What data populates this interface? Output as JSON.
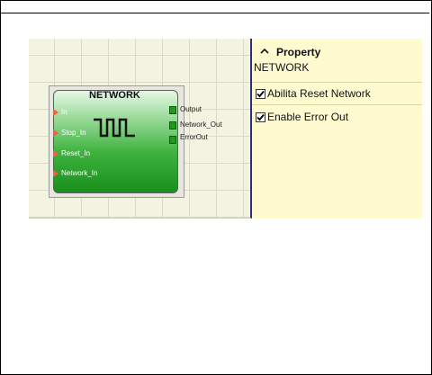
{
  "block": {
    "title": "NETWORK",
    "inputs": [
      "In",
      "Stop_In",
      "Reset_In",
      "Network_In"
    ],
    "outputs": [
      "Output",
      "Network_Out",
      "ErrorOut"
    ]
  },
  "property_panel": {
    "header": "Property",
    "subtitle": "NETWORK",
    "options": [
      {
        "label": "Abilita Reset Network",
        "checked": true
      },
      {
        "label": "Enable Error Out",
        "checked": true
      }
    ]
  },
  "colors": {
    "canvas_bg": "#f3f3e2",
    "panel_bg": "#fffad0",
    "block_green": "#3fb33f",
    "input_arrow": "#ff5a3a"
  }
}
